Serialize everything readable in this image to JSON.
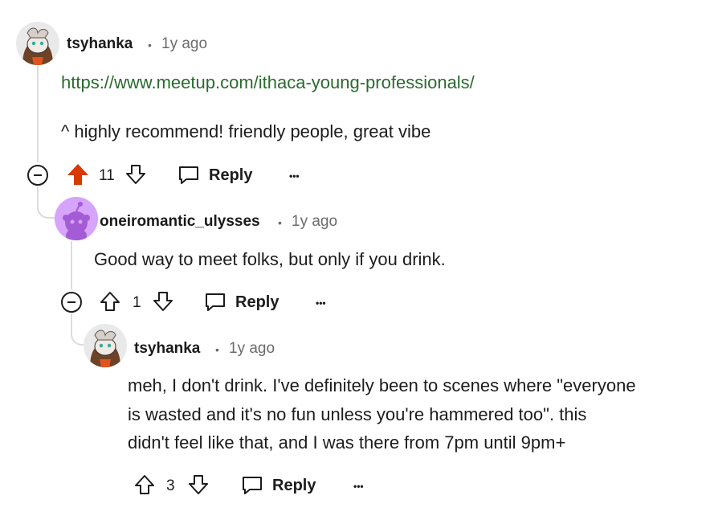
{
  "comments": [
    {
      "username": "tsyhanka",
      "separator": "•",
      "time": "1y ago",
      "link": "https://www.meetup.com/ithaca-young-professionals/",
      "text": "^ highly recommend! friendly people, great vibe",
      "votes": "11",
      "upvoted": true,
      "reply_label": "Reply",
      "more_label": "•••"
    },
    {
      "username": "oneiromantic_ulysses",
      "separator": "•",
      "time": "1y ago",
      "text": "Good way to meet folks, but only if you drink.",
      "votes": "1",
      "reply_label": "Reply",
      "more_label": "•••"
    },
    {
      "username": "tsyhanka",
      "separator": "•",
      "time": "1y ago",
      "text_lines": [
        "meh, I don't drink. I've definitely been to scenes where \"everyone",
        "is wasted and it's no fun unless you're hammered too\". this",
        "didn't feel like that, and I was there from 7pm until 9pm+"
      ],
      "votes": "3",
      "reply_label": "Reply",
      "more_label": "•••"
    }
  ],
  "colors": {
    "upvote_active": "#d93900",
    "link": "#2b6a2e",
    "meta": "#6b6b6b",
    "thread_line": "#d9dcdf"
  }
}
